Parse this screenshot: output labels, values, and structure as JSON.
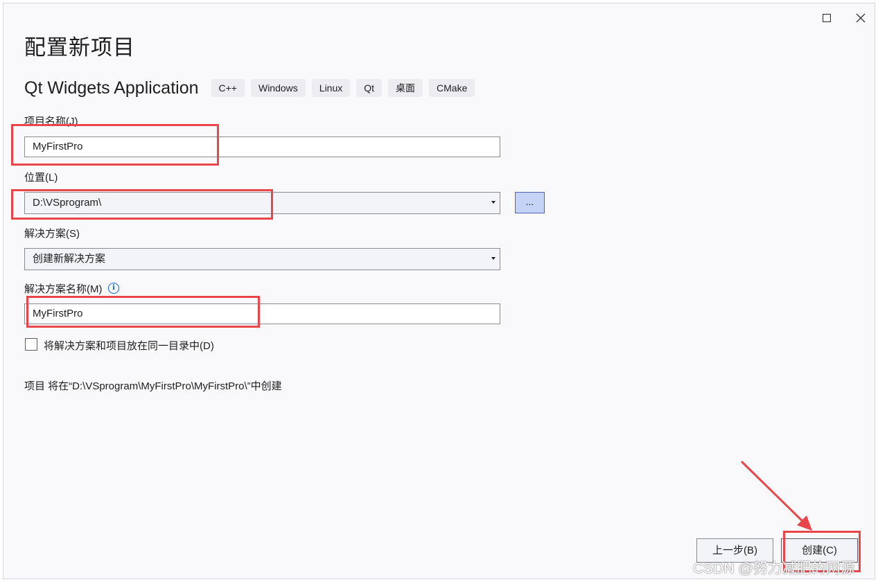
{
  "window": {
    "title": "配置新项目",
    "maximize_icon": "maximize-icon",
    "close_icon": "close-icon"
  },
  "template": {
    "name": "Qt Widgets Application",
    "tags": [
      "C++",
      "Windows",
      "Linux",
      "Qt",
      "桌面",
      "CMake"
    ]
  },
  "form": {
    "project_name_label": "项目名称(J)",
    "project_name_value": "MyFirstPro",
    "location_label": "位置(L)",
    "location_value": "D:\\VSprogram\\",
    "browse_label": "...",
    "solution_label": "解决方案(S)",
    "solution_value": "创建新解决方案",
    "solution_name_label": "解决方案名称(M)",
    "solution_name_value": "MyFirstPro",
    "same_dir_label": "将解决方案和项目放在同一目录中(D)",
    "same_dir_checked": false,
    "path_info": "项目 将在“D:\\VSprogram\\MyFirstPro\\MyFirstPro\\”中创建"
  },
  "footer": {
    "back_label": "上一步(B)",
    "create_label": "创建(C)"
  },
  "annotations": {
    "highlight_color": "#e8464b"
  },
  "watermark": "CSDN @努力减肥的网源"
}
